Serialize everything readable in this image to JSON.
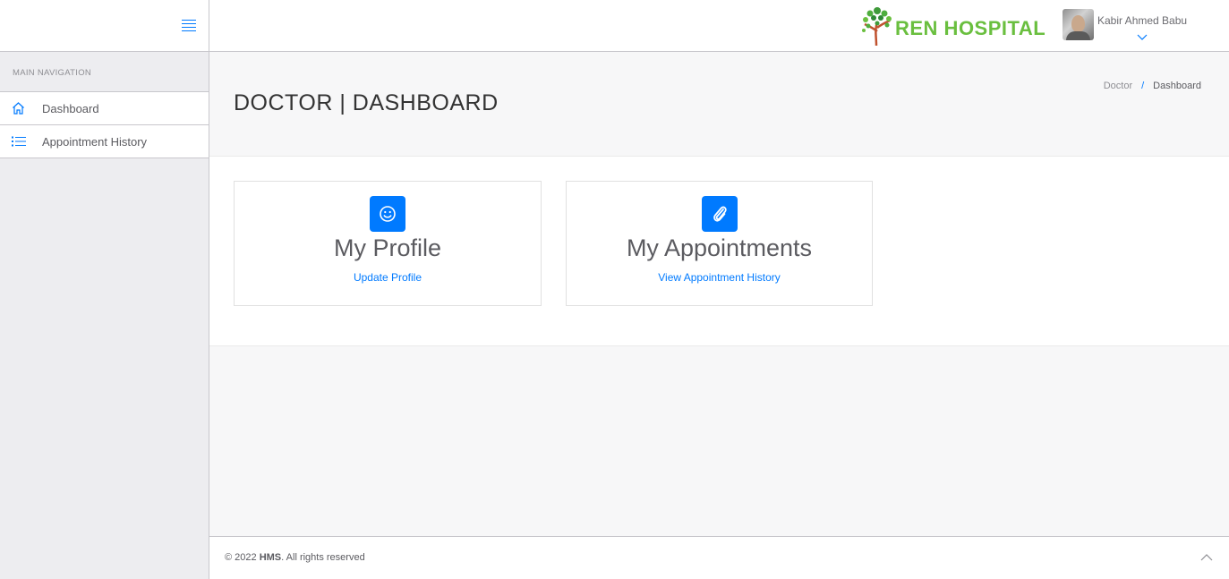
{
  "sidebar": {
    "caption": "MAIN NAVIGATION",
    "items": [
      {
        "label": "Dashboard",
        "icon": "home-icon"
      },
      {
        "label": "Appointment History",
        "icon": "list-icon"
      }
    ]
  },
  "header": {
    "logo_text": "REN HOSPITAL",
    "user_name": "Kabir Ahmed Babu"
  },
  "page": {
    "title": "DOCTOR | DASHBOARD",
    "breadcrumb": [
      "Doctor",
      "Dashboard"
    ]
  },
  "cards": [
    {
      "title": "My Profile",
      "link": "Update Profile",
      "icon": "smile-icon"
    },
    {
      "title": "My Appointments",
      "link": "View Appointment History",
      "icon": "paperclip-icon"
    }
  ],
  "footer": {
    "prefix": "© 2022",
    "brand": "HMS",
    "suffix": ". All rights reserved"
  },
  "colors": {
    "accent": "#007aff",
    "logo_green": "#6abf3f",
    "sidebar_bg": "#ededf0"
  }
}
